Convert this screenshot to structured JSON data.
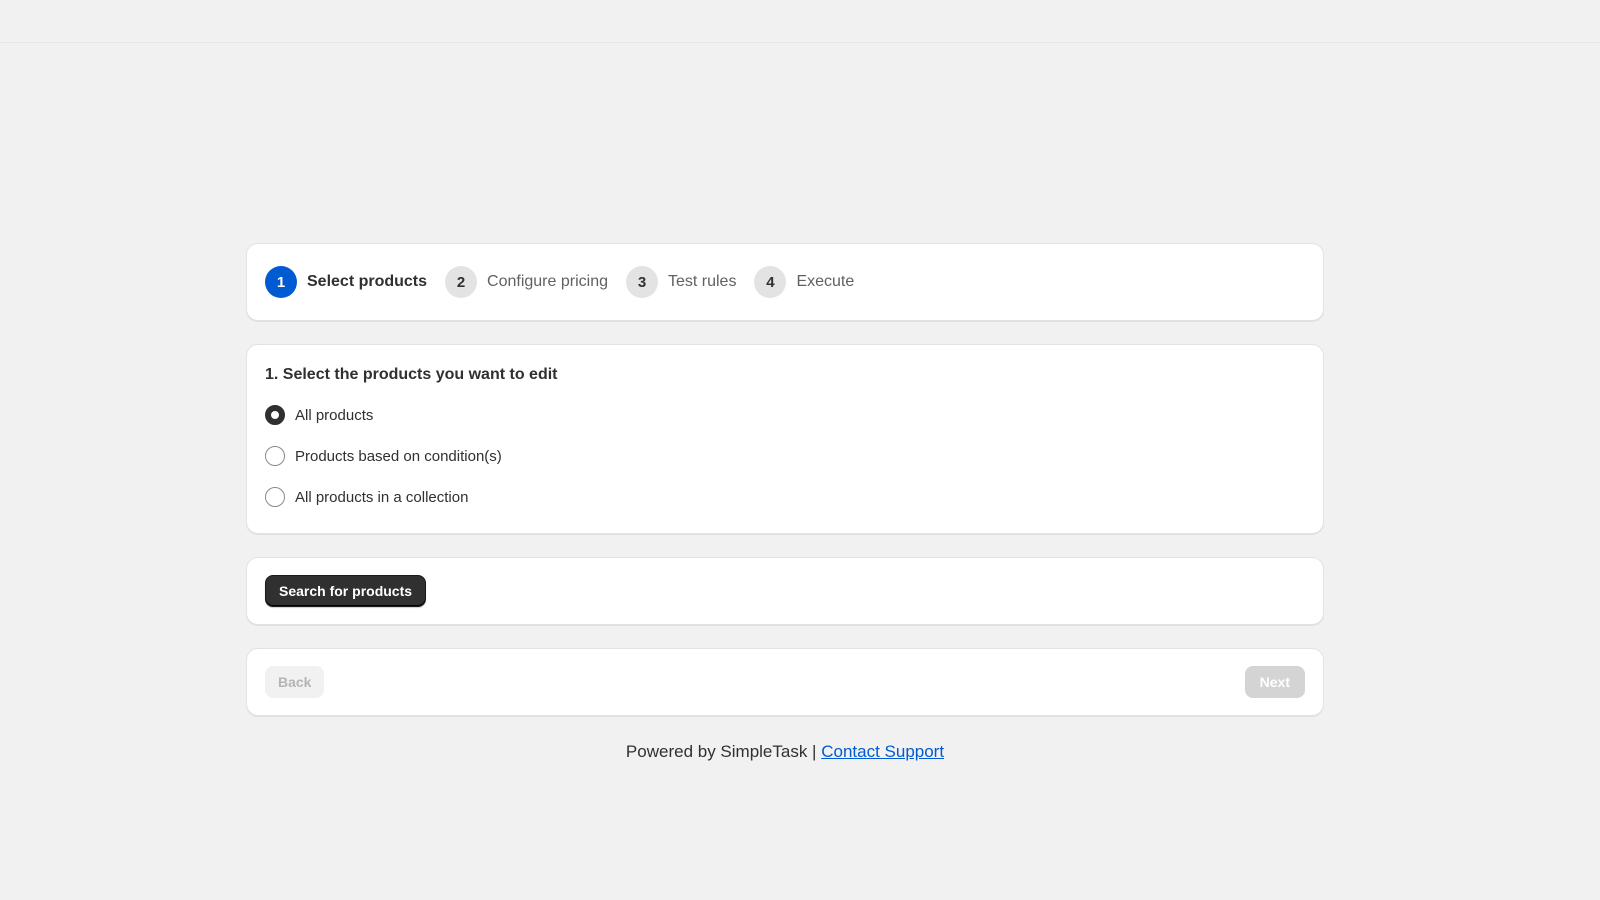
{
  "steps": [
    {
      "number": "1",
      "label": "Select products",
      "active": true
    },
    {
      "number": "2",
      "label": "Configure pricing",
      "active": false
    },
    {
      "number": "3",
      "label": "Test rules",
      "active": false
    },
    {
      "number": "4",
      "label": "Execute",
      "active": false
    }
  ],
  "selection": {
    "title": "1. Select the products you want to edit",
    "options": [
      {
        "label": "All products",
        "checked": true
      },
      {
        "label": "Products based on condition(s)",
        "checked": false
      },
      {
        "label": "All products in a collection",
        "checked": false
      }
    ]
  },
  "search": {
    "button_label": "Search for products"
  },
  "navigation": {
    "back_label": "Back",
    "next_label": "Next"
  },
  "footer": {
    "powered_by": "Powered by SimpleTask |",
    "support_link": "Contact Support"
  },
  "colors": {
    "accent": "#005bd3",
    "primary_button": "#303030",
    "background": "#f1f1f1"
  }
}
